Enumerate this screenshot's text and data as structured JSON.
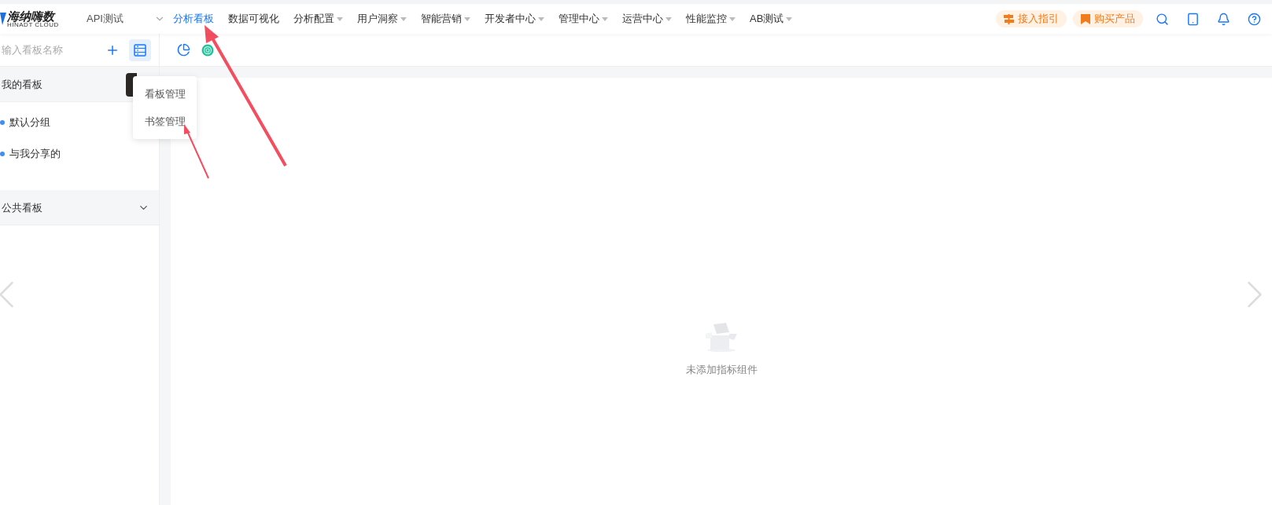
{
  "header": {
    "logo": {
      "name": "海纳嗨数",
      "subtitle": "HINADT CLOUD"
    },
    "project": "API测试",
    "nav": [
      {
        "label": "分析看板",
        "selected": true,
        "dropdown": false
      },
      {
        "label": "数据可视化",
        "selected": false,
        "dropdown": false
      },
      {
        "label": "分析配置",
        "selected": false,
        "dropdown": true
      },
      {
        "label": "用户洞察",
        "selected": false,
        "dropdown": true
      },
      {
        "label": "智能营销",
        "selected": false,
        "dropdown": true
      },
      {
        "label": "开发者中心",
        "selected": false,
        "dropdown": true
      },
      {
        "label": "管理中心",
        "selected": false,
        "dropdown": true
      },
      {
        "label": "运营中心",
        "selected": false,
        "dropdown": true
      },
      {
        "label": "性能监控",
        "selected": false,
        "dropdown": true
      },
      {
        "label": "AB测试",
        "selected": false,
        "dropdown": true
      }
    ],
    "actions": [
      {
        "kind": "guide",
        "label": "接入指引"
      },
      {
        "kind": "buy",
        "label": "购买产品"
      }
    ]
  },
  "sidebar": {
    "search": {
      "placeholder": "输入看板名称"
    },
    "sections": [
      {
        "title": "我的看板",
        "expanded": true,
        "items": [
          {
            "label": "默认分组"
          },
          {
            "label": "与我分享的"
          }
        ]
      },
      {
        "title": "公共看板",
        "expanded": false
      }
    ]
  },
  "menu": {
    "items": [
      {
        "label": "看板管理"
      },
      {
        "label": "书签管理"
      }
    ]
  },
  "empty_state": {
    "text": "未添加指标组件"
  }
}
